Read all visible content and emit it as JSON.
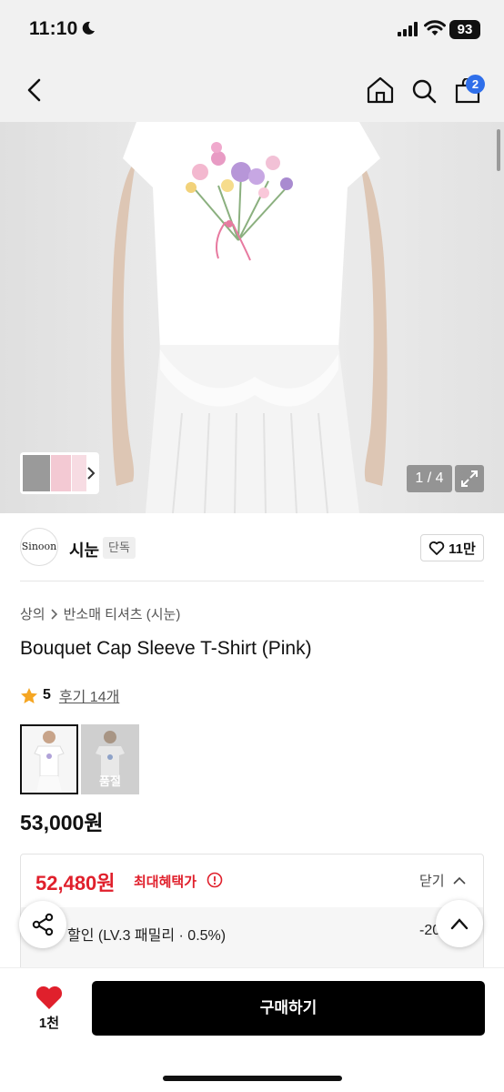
{
  "status": {
    "time": "11:10",
    "battery": "93"
  },
  "nav": {
    "cart_count": "2"
  },
  "gallery": {
    "counter": "1 / 4"
  },
  "brand": {
    "logo_text": "Sinoon",
    "name": "시눈",
    "tag": "단독",
    "likes": "11만"
  },
  "breadcrumb": {
    "category": "상의",
    "sub": "반소매 티셔츠 (시눈)"
  },
  "product": {
    "title": "Bouquet Cap Sleeve T-Shirt (Pink)",
    "rating": "5",
    "reviews": "후기 14개",
    "soldout_label": "품절",
    "price": "53,000원"
  },
  "benefit": {
    "price": "52,480원",
    "label": "최대혜택가",
    "close": "닫기",
    "discount_label": "할인 (LV.3 패밀리 · 0.5%)",
    "discount_value": "-20"
  },
  "bottom": {
    "like_count": "1천",
    "buy_label": "구매하기"
  },
  "colors": {
    "accent_red": "#e0202c",
    "badge_blue": "#2f6fea",
    "star": "#f5a623"
  }
}
